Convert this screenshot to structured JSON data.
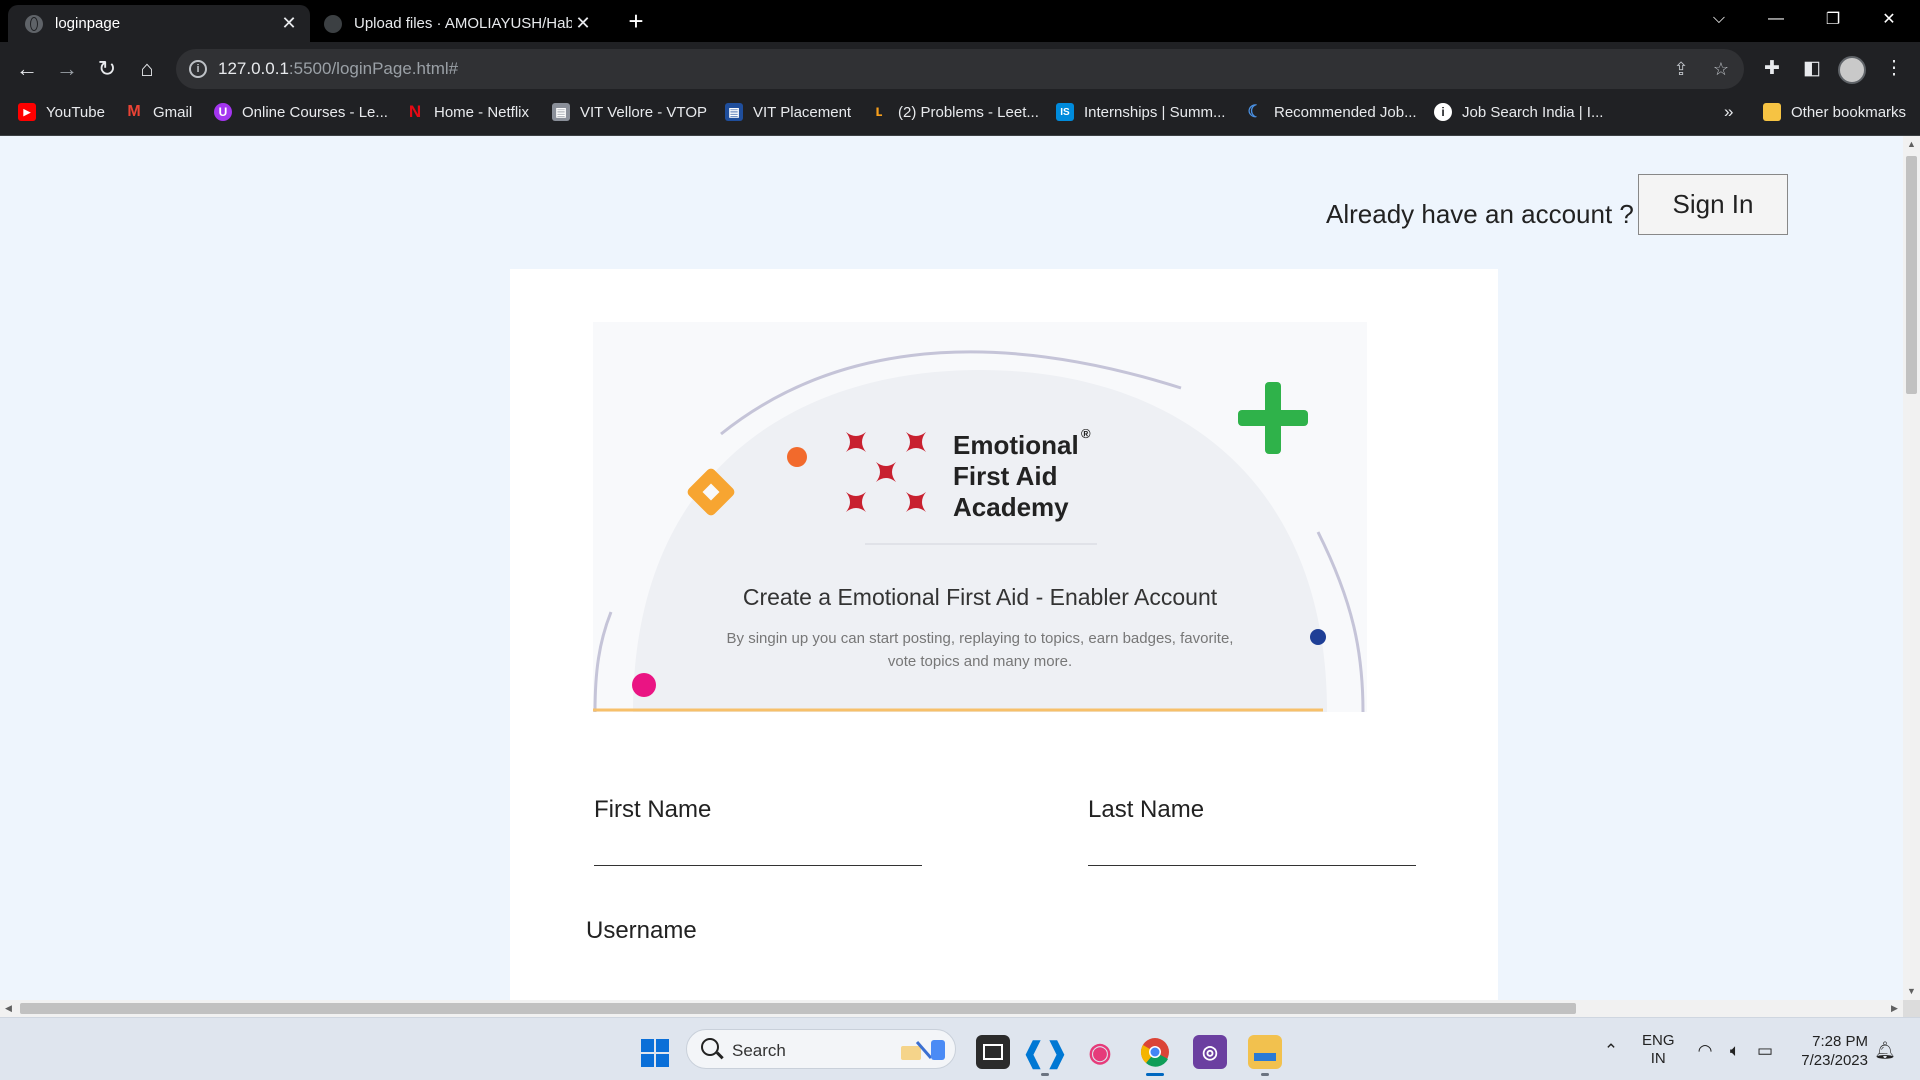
{
  "browser": {
    "tabs": [
      {
        "title": "loginpage",
        "close": "✕"
      },
      {
        "title": "Upload files · AMOLIAYUSH/Habi",
        "close": "✕"
      }
    ],
    "new_tab": "+",
    "window_controls": {
      "tab_search": "⌵",
      "minimize": "—",
      "restore": "❐",
      "close": "✕"
    },
    "address": {
      "host": "127.0.0.1",
      "rest": ":5500/loginPage.html#"
    },
    "bookmarks": [
      {
        "label": "YouTube",
        "icon": "youtube-icon",
        "color": "#ff0000",
        "glyph": "▶"
      },
      {
        "label": "Gmail",
        "icon": "gmail-icon",
        "color": "#ea4335",
        "glyph": "M"
      },
      {
        "label": "Online Courses - Le...",
        "icon": "udemy-icon",
        "color": "#a435f0",
        "glyph": "U"
      },
      {
        "label": "Home - Netflix",
        "icon": "netflix-icon",
        "color": "#e50914",
        "glyph": "N"
      },
      {
        "label": "VIT Vellore - VTOP",
        "icon": "vtop-icon",
        "color": "#8a8f99",
        "glyph": "▤"
      },
      {
        "label": "VIT Placement",
        "icon": "vit-placement-icon",
        "color": "#1f4e9c",
        "glyph": "▤"
      },
      {
        "label": "(2) Problems - Leet...",
        "icon": "leetcode-icon",
        "color": "#f89f1b",
        "glyph": "ʟ"
      },
      {
        "label": "Internships | Summ...",
        "icon": "internshala-icon",
        "color": "#008bdc",
        "glyph": "IS"
      },
      {
        "label": "Recommended Job...",
        "icon": "naukri-icon",
        "color": "#4a90e2",
        "glyph": "☾"
      },
      {
        "label": "Job Search India | I...",
        "icon": "indeed-icon",
        "color": "#ffffff",
        "glyph": "i"
      }
    ],
    "bookmarks_overflow": "»",
    "other_bookmarks": "Other bookmarks"
  },
  "page": {
    "already_text": "Already have an account ?",
    "signin_label": "Sign In",
    "brand_name": [
      "Emotional",
      "First Aid",
      "Academy"
    ],
    "brand_reg": "®",
    "banner_title": "Create a Emotional First Aid - Enabler Account",
    "banner_subtitle": "By singin up you can start posting, replaying to topics, earn badges, favorite, vote topics and many more.",
    "fields": {
      "first_name": {
        "label": "First Name",
        "value": ""
      },
      "last_name": {
        "label": "Last Name",
        "value": ""
      },
      "username": {
        "label": "Username",
        "value": ""
      }
    },
    "colors": {
      "page_bg": "#eef5fd",
      "brand_red": "#c8202f",
      "plus_green": "#2fb24a",
      "accent_orange": "#f7a531"
    }
  },
  "taskbar": {
    "search_label": "Search",
    "apps": [
      {
        "name": "task-view-icon"
      },
      {
        "name": "vscode-icon"
      },
      {
        "name": "color-picker-icon"
      },
      {
        "name": "chrome-icon"
      },
      {
        "name": "purple-app-icon"
      },
      {
        "name": "file-explorer-icon"
      }
    ],
    "lang": [
      "ENG",
      "IN"
    ],
    "time": "7:28 PM",
    "date": "7/23/2023"
  }
}
